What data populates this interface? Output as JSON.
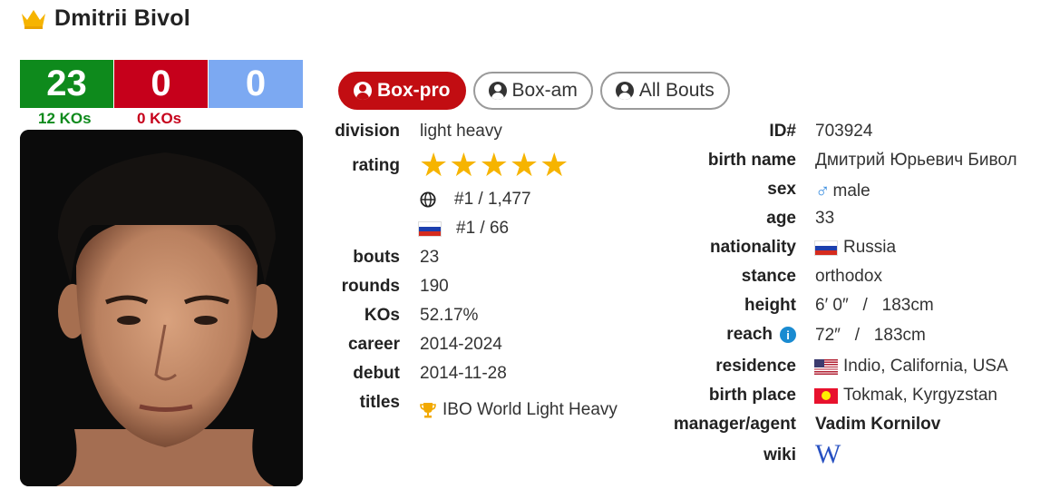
{
  "boxer": {
    "name": "Dmitrii Bivol"
  },
  "record": {
    "wins": "23",
    "losses": "0",
    "draws": "0",
    "win_kos": "12 KOs",
    "loss_kos": "0 KOs"
  },
  "tabs": [
    {
      "label": "Box-pro",
      "active": true
    },
    {
      "label": "Box-am"
    },
    {
      "label": "All Bouts"
    }
  ],
  "left_labels": {
    "division": "division",
    "rating": "rating",
    "bouts": "bouts",
    "rounds": "rounds",
    "kos": "KOs",
    "career": "career",
    "debut": "debut",
    "titles": "titles"
  },
  "left_values": {
    "division": "light heavy",
    "rating_stars": 5,
    "world_rank": "#1 / 1,477",
    "country_rank": "#1 / 66",
    "bouts": "23",
    "rounds": "190",
    "kos": "52.17%",
    "career": "2014-2024",
    "debut": "2014-11-28",
    "title": "IBO World Light Heavy"
  },
  "right_labels": {
    "id": "ID#",
    "birth_name": "birth name",
    "sex": "sex",
    "age": "age",
    "nationality": "nationality",
    "stance": "stance",
    "height": "height",
    "reach": "reach",
    "residence": "residence",
    "birth_place": "birth place",
    "manager": "manager/agent",
    "wiki": "wiki"
  },
  "right_values": {
    "id": "703924",
    "birth_name": "Дмитрий Юрьевич Бивол",
    "sex": "male",
    "age": "33",
    "nationality": "Russia",
    "stance": "orthodox",
    "height": "6′ 0″   /   183cm",
    "reach": "72″   /   183cm",
    "residence": "Indio, California, USA",
    "birth_place": "Tokmak, Kyrgyzstan",
    "manager": "Vadim Kornilov",
    "wiki_symbol": "W"
  },
  "icons": {
    "crown": "crown-icon",
    "person": "person-icon",
    "star": "star-icon",
    "globe": "globe-icon",
    "trophy": "trophy-icon",
    "male": "male-icon",
    "info": "info-icon",
    "wiki": "wikipedia-icon"
  },
  "colors": {
    "win": "#0e8a1c",
    "loss": "#c6001b",
    "draw": "#7ca9f2",
    "accent": "#c20d12",
    "star": "#f6b400"
  }
}
